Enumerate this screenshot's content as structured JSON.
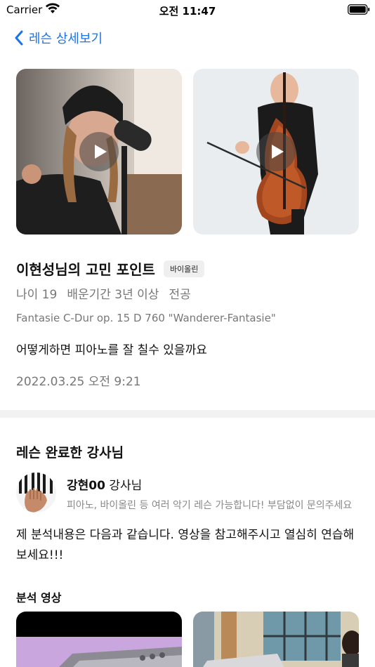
{
  "status_bar": {
    "carrier": "Carrier",
    "time": "오전 11:47"
  },
  "nav": {
    "back_label": "레슨 상세보기"
  },
  "lesson": {
    "title": "이현성님의 고민 포인트",
    "instrument_badge": "바이올린",
    "meta": {
      "age": "나이 19",
      "duration": "배운기간 3년 이상",
      "major": "전공"
    },
    "song": "Fantasie C-Dur op. 15 D 760 \"Wanderer-Fantasie\"",
    "question": "어떻게하면 피아노를 잘 칠수 있을까요",
    "timestamp": "2022.03.25 오전 9:21",
    "videos": [
      {
        "icon": "play-icon"
      },
      {
        "icon": "play-icon"
      }
    ]
  },
  "completed_section": {
    "heading": "레슨 완료한 강사님",
    "teacher": {
      "name": "강현00",
      "suffix": " 강사님",
      "description": "피아노, 바이올린 등 여러 악기 레슨 가능합니다! 부담없이 문의주세요"
    },
    "analysis_text": "제 분석내용은 다음과 같습니다. 영상을 참고해주시고 열심히 연습해보세요!!!",
    "analysis_video_heading": "분석 영상"
  },
  "colors": {
    "accent": "#1a73e8",
    "secondary_text": "#777777",
    "divider": "#f2f2f2"
  }
}
